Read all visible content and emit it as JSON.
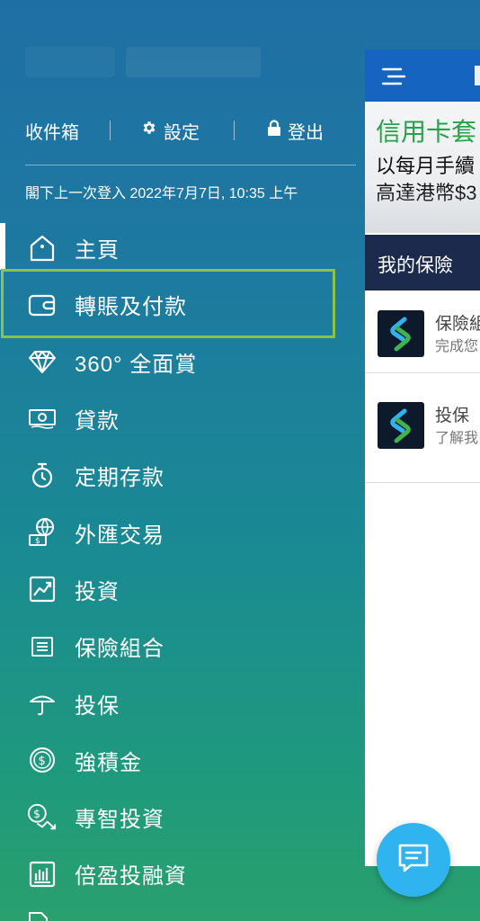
{
  "header": {
    "inbox_label": "收件箱",
    "settings_label": "設定",
    "logout_label": "登出",
    "settings_icon": "gear-icon",
    "logout_icon": "lock-icon"
  },
  "last_login": "閣下上一次登入 2022年7月7日, 10:35 上午",
  "menu": {
    "items": [
      {
        "label": "主頁",
        "icon": "home-icon"
      },
      {
        "label": "轉賬及付款",
        "icon": "wallet-icon"
      },
      {
        "label": "360° 全面賞",
        "icon": "diamond-icon"
      },
      {
        "label": "貸款",
        "icon": "banknote-icon"
      },
      {
        "label": "定期存款",
        "icon": "timer-icon"
      },
      {
        "label": "外匯交易",
        "icon": "fx-globe-icon"
      },
      {
        "label": "投資",
        "icon": "chart-icon"
      },
      {
        "label": "保險組合",
        "icon": "list-icon"
      },
      {
        "label": "投保",
        "icon": "umbrella-icon"
      },
      {
        "label": "強積金",
        "icon": "dollar-coin-icon"
      },
      {
        "label": "專智投資",
        "icon": "dollar-growth-icon"
      },
      {
        "label": "倍盈投融資",
        "icon": "bar-chart-icon"
      }
    ]
  },
  "panel": {
    "banner": {
      "line1": "信用卡套",
      "line2": "以每月手續",
      "line3": "高達港幣$3"
    },
    "section_title": "我的保險",
    "items": [
      {
        "title": "保險組",
        "subtitle": "完成您"
      },
      {
        "title": "投保",
        "subtitle": "了解我"
      }
    ]
  },
  "colors": {
    "accent_highlight": "#8bc34a",
    "panel_header": "#1565c0",
    "section_bar": "#1c2a4d",
    "chat_fab": "#2fb4f0",
    "banner_green": "#25a24a"
  }
}
